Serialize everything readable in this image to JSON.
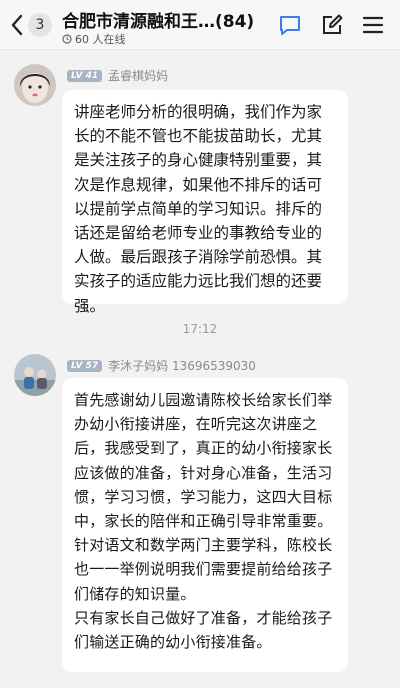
{
  "header": {
    "back_count": "3",
    "title": "合肥市清源融和王…(84)",
    "online_text": "60 人在线",
    "icons": [
      "chevron-left-icon",
      "chat-icon",
      "edit-icon",
      "menu-icon"
    ],
    "accent": "#3b7fe6"
  },
  "messages": [
    {
      "level": "LV 41",
      "sender": "孟睿棋妈妈",
      "paragraphs": [
        "讲座老师分析的很明确，我们作为家长的不能不管也不能拔苗助长，尤其是关注孩子的身心健康特别重要，其次是作息规律，如果他不排斥的话可以提前学点简单的学习知识。排斥的话还是留给老师专业的事教给专业的人做。最后跟孩子消除学前恐惧。其实孩子的适应能力远比我们想的还要强。"
      ]
    },
    {
      "level": "LV 57",
      "sender": "李沐子妈妈 13696539030",
      "paragraphs": [
        "首先感谢幼儿园邀请陈校长给家长们举办幼小衔接讲座，在听完这次讲座之后，我感受到了，真正的幼小衔接家长应该做的准备，针对身心准备，生活习惯，学习习惯，学习能力，这四大目标中，家长的陪伴和正确引导非常重要。",
        "针对语文和数学两门主要学科，陈校长也一一举例说明我们需要提前给给孩子们储存的知识量。",
        "只有家长自己做好了准备，才能给孩子们输送正确的幼小衔接准备。"
      ]
    }
  ],
  "timestamp": "17:12"
}
